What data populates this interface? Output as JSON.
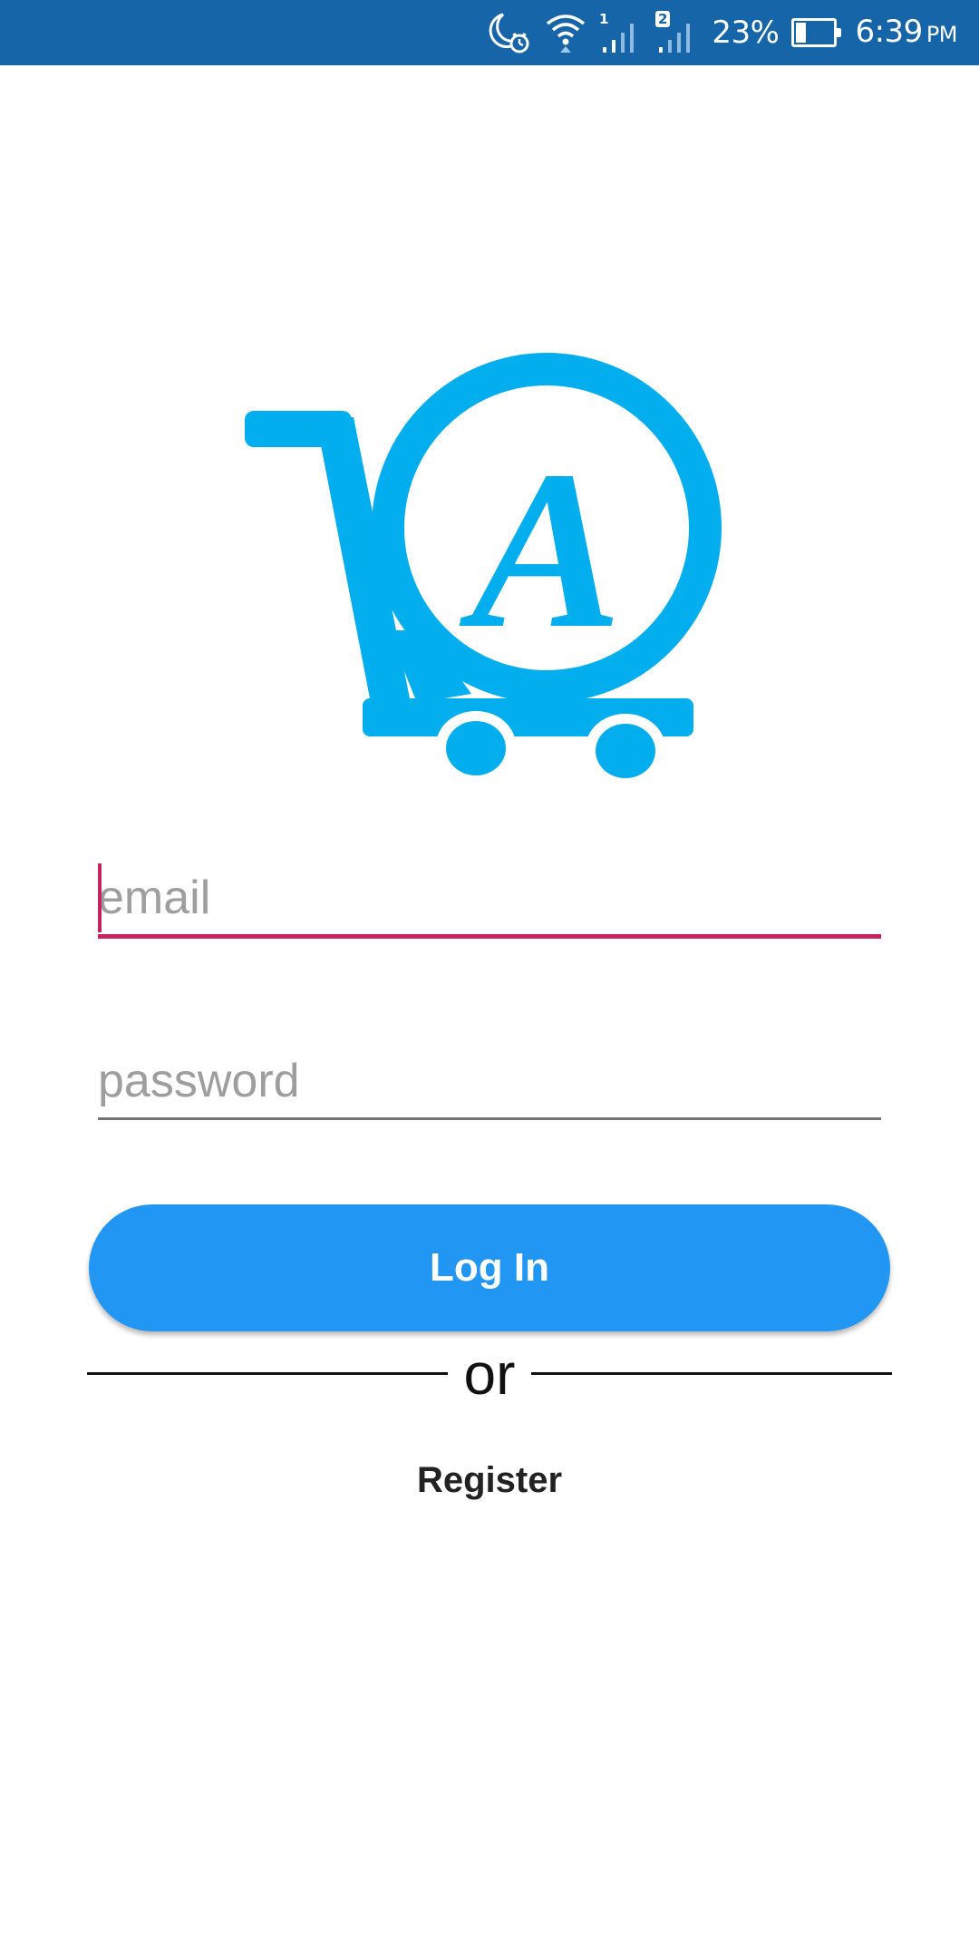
{
  "status_bar": {
    "background_color": "#1565a8",
    "icons": [
      "do-not-disturb-alarm-icon",
      "wifi-icon",
      "sim1-signal-icon",
      "sim2-signal-icon",
      "battery-icon"
    ],
    "sim1_label": "1",
    "sim2_label": "2",
    "battery_percent": "23%",
    "battery_level": 0.23,
    "time": "6:39",
    "ampm": "PM"
  },
  "logo": {
    "icon": "shopping-cart-a-logo-icon",
    "color": "#03aeef",
    "letter": "A"
  },
  "form": {
    "email_placeholder": "email",
    "password_placeholder": "password",
    "focus_color": "#c8235d"
  },
  "login_button": {
    "label": "Log In",
    "color": "#2196f3"
  },
  "divider_text": "or",
  "register_label": "Register"
}
